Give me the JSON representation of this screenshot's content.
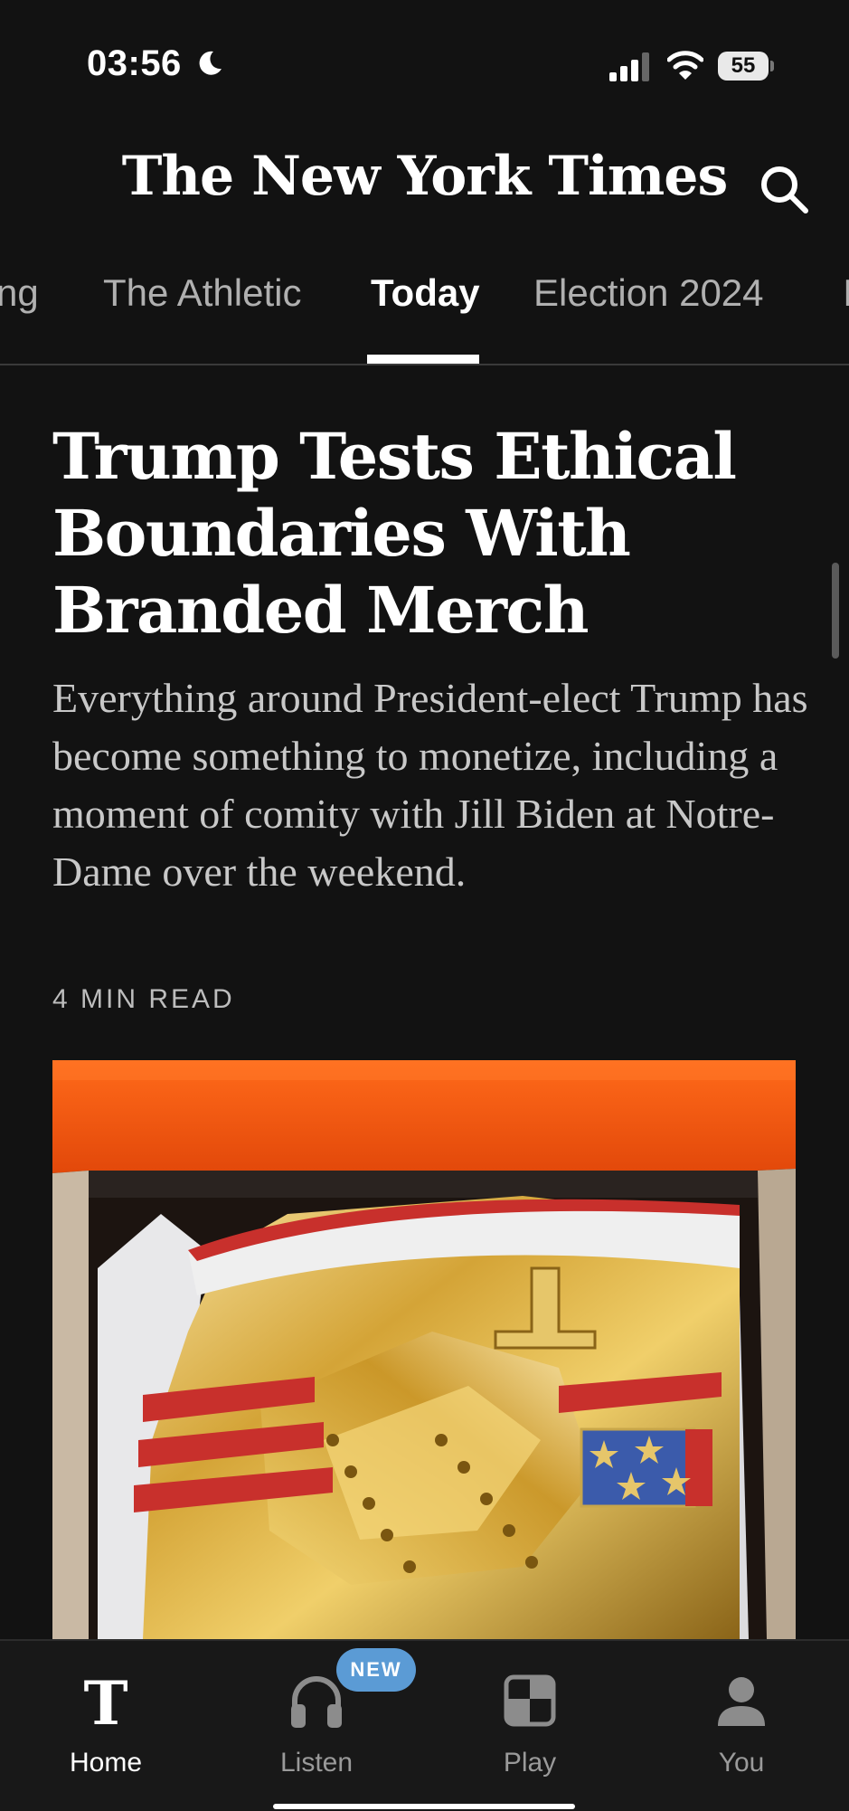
{
  "status_bar": {
    "time": "03:56",
    "battery": "55"
  },
  "masthead": {
    "logo_text": "The New York Times",
    "search_icon": "search-icon"
  },
  "tabs": [
    {
      "label": "ng"
    },
    {
      "label": "The Athletic"
    },
    {
      "label": "Today",
      "active": true
    },
    {
      "label": "Election 2024"
    },
    {
      "label": "I"
    }
  ],
  "article": {
    "headline": "Trump Tests Ethical Boundaries With Branded Merch",
    "summary": "Everything around President-elect Trump has become something to monetize, including a moment of comity with Jill Biden at Notre-Dame over the weekend.",
    "read_time": "4 MIN READ"
  },
  "bottom_nav": {
    "items": [
      {
        "label": "Home",
        "icon": "nyt-t-logo-icon",
        "active": true
      },
      {
        "label": "Listen",
        "icon": "headphones-icon"
      },
      {
        "label": "Play",
        "icon": "games-grid-icon"
      },
      {
        "label": "You",
        "icon": "person-icon"
      }
    ],
    "listen_badge": "NEW"
  },
  "colors": {
    "background": "#121212",
    "accent_badge": "#5b9bd5",
    "text_secondary": "#c8c8c8"
  }
}
